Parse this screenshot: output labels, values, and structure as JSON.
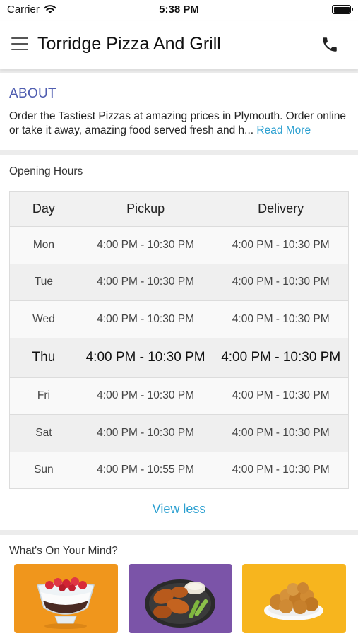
{
  "status_bar": {
    "carrier": "Carrier",
    "time": "5:38 PM"
  },
  "header": {
    "title": "Torridge Pizza And Grill"
  },
  "about": {
    "heading": "ABOUT",
    "text": "Order the Tastiest Pizzas at amazing prices in Plymouth. Order online or take it away, amazing food served fresh and h...",
    "read_more": "Read More"
  },
  "opening_hours": {
    "heading": "Opening Hours",
    "columns": [
      "Day",
      "Pickup",
      "Delivery"
    ],
    "rows": [
      {
        "day": "Mon",
        "pickup": "4:00 PM - 10:30 PM",
        "delivery": "4:00 PM - 10:30 PM"
      },
      {
        "day": "Tue",
        "pickup": "4:00 PM - 10:30 PM",
        "delivery": "4:00 PM - 10:30 PM"
      },
      {
        "day": "Wed",
        "pickup": "4:00 PM - 10:30 PM",
        "delivery": "4:00 PM - 10:30 PM"
      },
      {
        "day": "Thu",
        "pickup": "4:00 PM - 10:30 PM",
        "delivery": "4:00 PM - 10:30 PM",
        "highlighted": true
      },
      {
        "day": "Fri",
        "pickup": "4:00 PM - 10:30 PM",
        "delivery": "4:00 PM - 10:30 PM"
      },
      {
        "day": "Sat",
        "pickup": "4:00 PM - 10:30 PM",
        "delivery": "4:00 PM - 10:30 PM"
      },
      {
        "day": "Sun",
        "pickup": "4:00 PM - 10:55 PM",
        "delivery": "4:00 PM - 10:30 PM"
      }
    ],
    "view_less": "View less"
  },
  "whats_on_your_mind": {
    "heading": "What's On Your Mind?",
    "tiles": [
      {
        "icon": "dessert-bowl-icon",
        "color": "#f0961c"
      },
      {
        "icon": "chicken-wings-icon",
        "color": "#7b54a8"
      },
      {
        "icon": "fried-chicken-icon",
        "color": "#f7b51e"
      }
    ]
  },
  "colors": {
    "accent_link": "#2a9fd0",
    "about_heading": "#4f5db0",
    "page_background": "#ececec"
  }
}
